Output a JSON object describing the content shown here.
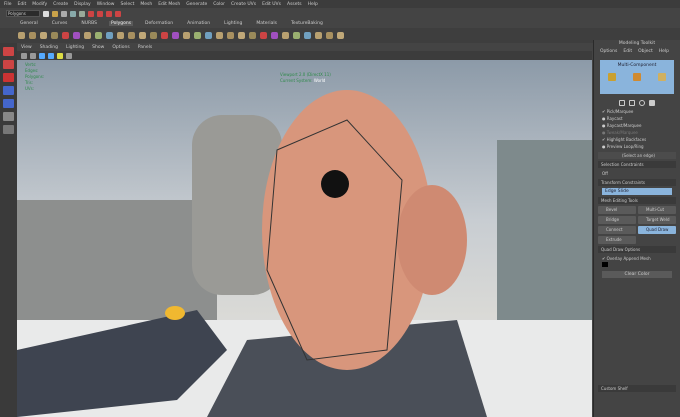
{
  "menubar": [
    "File",
    "Edit",
    "Modify",
    "Create",
    "Display",
    "Window",
    "Select",
    "Mesh",
    "Edit Mesh",
    "Generate",
    "Color",
    "Create UVs",
    "Edit UVs",
    "Assets",
    "Help"
  ],
  "status": {
    "mode": "Polygons"
  },
  "shelf_tabs": [
    {
      "label": "General"
    },
    {
      "label": "Curves"
    },
    {
      "label": "NURBS"
    },
    {
      "label": "Polygons",
      "active": true
    },
    {
      "label": "Deformation"
    },
    {
      "label": "Animation"
    },
    {
      "label": "Lighting"
    },
    {
      "label": "Materials"
    },
    {
      "label": "TextureBaking"
    }
  ],
  "viewport": {
    "menu": [
      "View",
      "Shading",
      "Lighting",
      "Show",
      "Options",
      "Panels"
    ],
    "hud_labels": [
      "Verts:",
      "Edges:",
      "Polygons:",
      "Tris:",
      "UVs:"
    ],
    "renderer": "Viewport 2.0 (DirectX 11)",
    "system_label": "Current System:",
    "system_value": "World"
  },
  "panel": {
    "title": "Modeling Toolkit",
    "menu": [
      "Options",
      "Edit",
      "Object",
      "Help"
    ],
    "multi_component": "Multi-Component",
    "options": [
      {
        "label": "Pick/Marquee",
        "checked": true
      },
      {
        "label": "Raycast"
      },
      {
        "label": "Raycast/Marquee"
      },
      {
        "label": "Tweak/Marquee",
        "disabled": true
      },
      {
        "label": "Highlight Backfaces",
        "checked": true
      },
      {
        "label": "Preview Loop/Ring"
      }
    ],
    "select_edge": "(Select an edge)",
    "selection_constraints": "Selection Constraints",
    "off": "Off",
    "transform_constraints": "Transform Constraints",
    "edge_slide": "Edge Slide",
    "mesh_editing_tools": "Mesh Editing Tools",
    "tools": [
      "Bevel",
      "Multi-Cut",
      "Bridge",
      "Target Weld",
      "Connect",
      "Quad Draw",
      "Extrude"
    ],
    "active_tool": "Quad Draw",
    "quad_draw_options": "Quad Draw Options",
    "overlay": "Overlay Append Mesh",
    "clear_color": "Clear Color",
    "custom_shelf": "Custom Shelf"
  },
  "colors": {
    "accent": "#5285a6",
    "selection": "#8ab4dc"
  }
}
